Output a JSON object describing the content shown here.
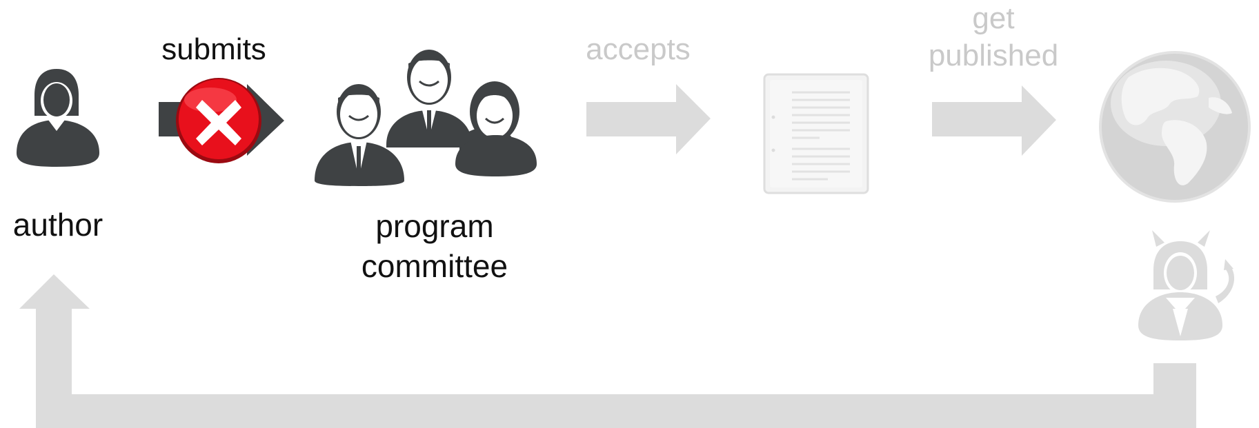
{
  "labels": {
    "author": "author",
    "submits": "submits",
    "committee_line1": "program",
    "committee_line2": "committee",
    "accepts": "accepts",
    "published_line1": "get",
    "published_line2": "published"
  },
  "icons": {
    "author": "person-female-icon",
    "reject": "x-circle-icon",
    "committee": "group-people-icon",
    "paper": "document-icon",
    "world": "globe-icon",
    "reader": "devil-woman-icon"
  },
  "colors": {
    "dark": "#3f4244",
    "faded": "#dcdcdc",
    "reject_red": "#e8101c",
    "text_dark": "#111111",
    "text_faded": "#c9c9c9"
  }
}
